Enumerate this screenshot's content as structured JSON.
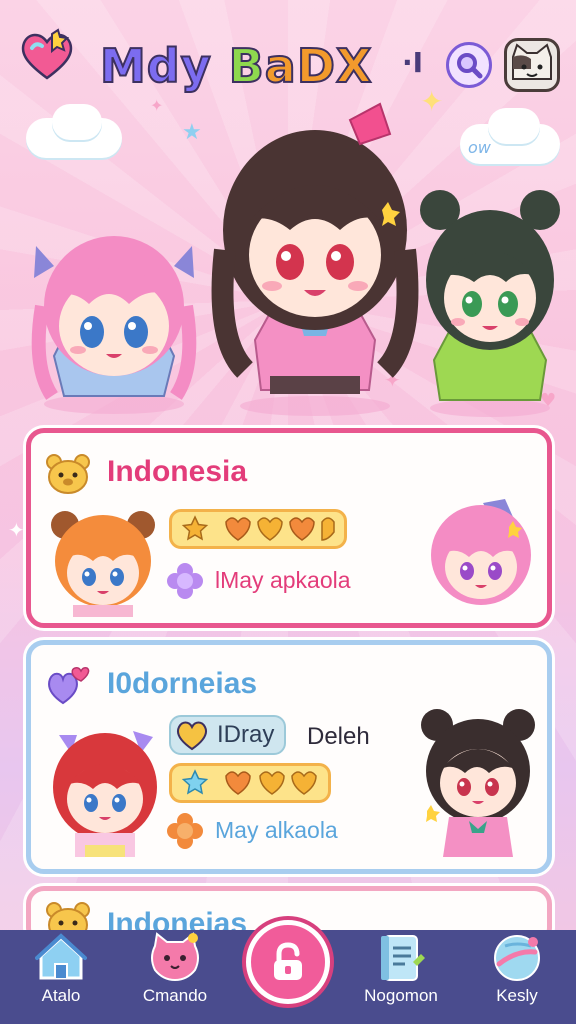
{
  "header": {
    "title_part1": "Mdy",
    "title_part2": "B",
    "title_part3": "aDX",
    "mark": "·I",
    "logo_icon": "heart-icon",
    "search_icon": "search-icon",
    "avatar_icon": "cat-avatar-icon"
  },
  "hero": {
    "characters": [
      "pink-hair-girl",
      "brown-hair-girl",
      "green-hair-girl"
    ],
    "cloud_text": "ow"
  },
  "cards": [
    {
      "title": "Indonesia",
      "icon": "bear-icon",
      "stars_icon": "rating-stars-icon",
      "subtitle": "lMay apkaola",
      "accent": "#e8578f"
    },
    {
      "title": "I0dorneias",
      "icon": "heart-icon",
      "pill_label": "IDray",
      "pill_side": "Deleh",
      "stars_icon": "rating-stars-icon",
      "subtitle": "May alkaola",
      "accent": "#a8cdef"
    },
    {
      "title": "Indoneias",
      "icon": "bear-icon",
      "accent": "#f3a7c2"
    }
  ],
  "nav": {
    "items": [
      {
        "label": "Atalo",
        "icon": "home-icon"
      },
      {
        "label": "Cmando",
        "icon": "pink-cat-icon"
      },
      {
        "label": "",
        "icon": "lock-icon"
      },
      {
        "label": "Nogomon",
        "icon": "notebook-icon"
      },
      {
        "label": "Kesly",
        "icon": "globe-icon"
      }
    ]
  },
  "colors": {
    "pink": "#e8578f",
    "blue": "#5aa5dc",
    "nav_bg": "#4a4c8e",
    "fab": "#f15c9a"
  }
}
